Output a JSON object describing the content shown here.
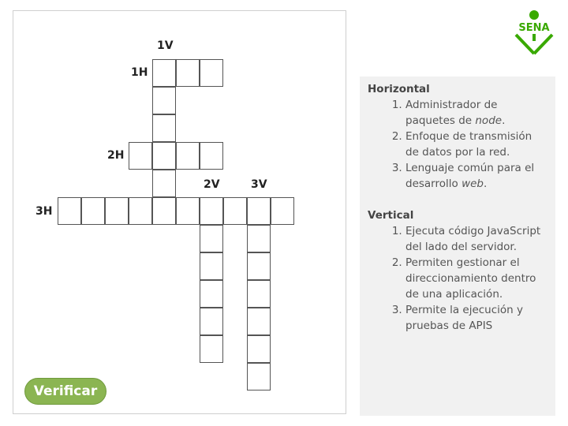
{
  "crossword": {
    "labels": {
      "v1": "1V",
      "h1": "1H",
      "h2": "2H",
      "v2": "2V",
      "v3": "3V",
      "h3": "3H"
    }
  },
  "verify_button": "Verificar",
  "logo": {
    "text": "SENA",
    "color": "#39a900"
  },
  "clues": {
    "horizontal": {
      "title": "Horizontal",
      "items": [
        {
          "pre": "Administrador de paquetes de ",
          "em": "node",
          "post": "."
        },
        {
          "pre": "Enfoque de transmisión de datos por la red.",
          "em": "",
          "post": ""
        },
        {
          "pre": "Lenguaje común para el desarrollo ",
          "em": "web",
          "post": "."
        }
      ]
    },
    "vertical": {
      "title": "Vertical",
      "items": [
        {
          "text": "Ejecuta código JavaScript del lado del servidor."
        },
        {
          "text": "Permiten gestionar el direccionamiento dentro de una aplicación."
        },
        {
          "text": "Permite la ejecución y pruebas de APIS"
        }
      ]
    }
  },
  "colors": {
    "button": "#8bb552",
    "panel": "#f1f1f1",
    "cell_border": "#555555"
  }
}
